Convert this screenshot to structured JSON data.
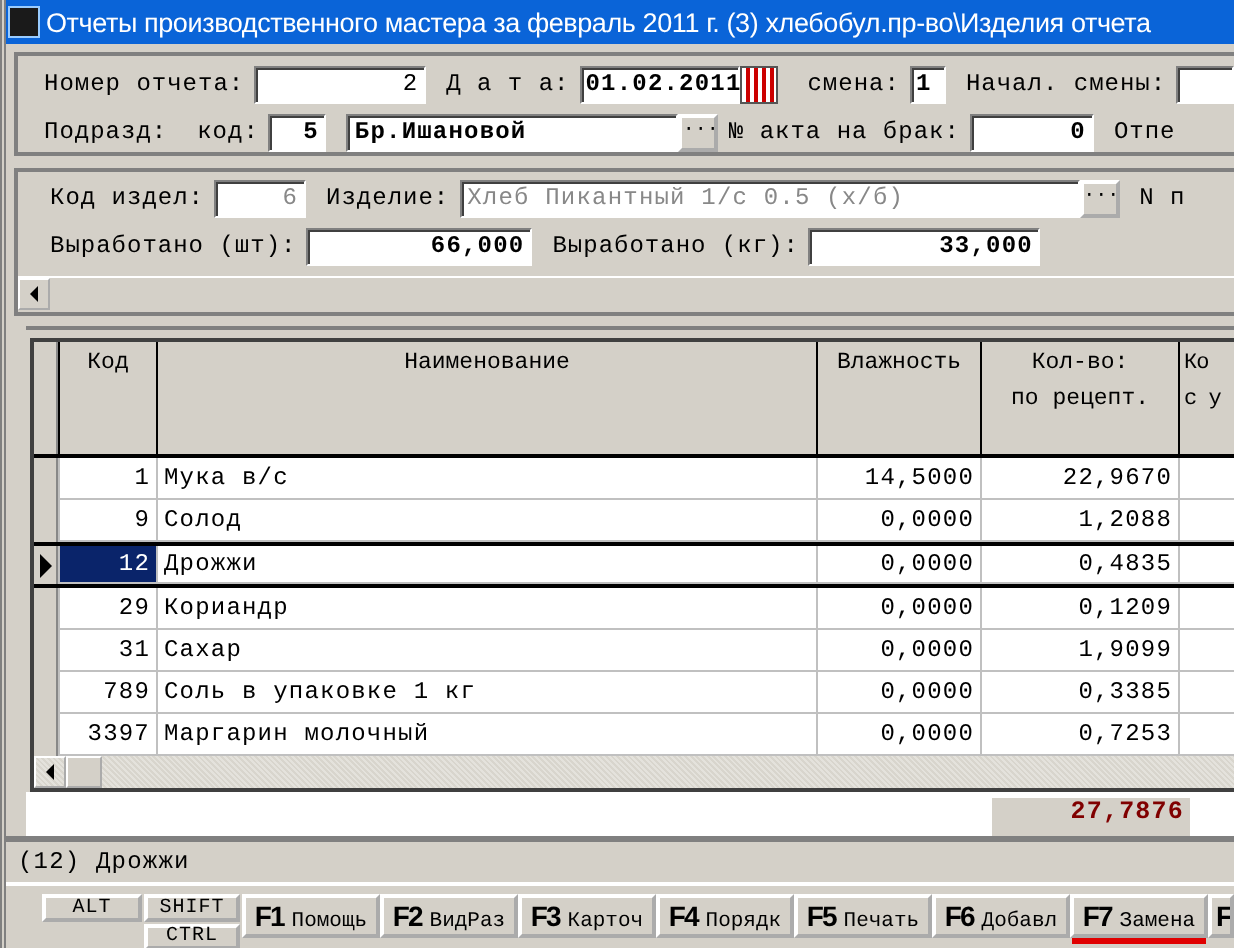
{
  "window": {
    "title": "Отчеты производственного мастера за февраль 2011 г. (3) хлебобул.пр-во\\Изделия отчета"
  },
  "header": {
    "report_number": {
      "label": "Номер отчета:",
      "value": "2"
    },
    "date": {
      "label": "Д а т а:",
      "value": "01.02.2011"
    },
    "shift": {
      "label": "смена:",
      "value": "1"
    },
    "shift_start": {
      "label": "Начал. смены:"
    },
    "subdivision": {
      "label": "Подразд:",
      "code_label": "код:",
      "code": "5",
      "name": "Бр.Ишановой",
      "browse_label": "···"
    },
    "defect_act": {
      "label": "№ акта на брак:",
      "value": "0"
    },
    "cut_label": "Отпе"
  },
  "product": {
    "code_label": "Код издел:",
    "code": "6",
    "product_label": "Изделие:",
    "product_value": "Хлеб Пикантный 1/с 0.5 (х/б)",
    "browse_label": "···",
    "n_label": "N п",
    "produced_pcs": {
      "label": "Выработано (шт):",
      "value": "66,000"
    },
    "produced_kg": {
      "label": "Выработано (кг):",
      "value": "33,000"
    }
  },
  "table": {
    "columns": [
      [
        "Код"
      ],
      [
        "Наименование"
      ],
      [
        "Влажность"
      ],
      [
        "Кол-во:",
        "по рецепт."
      ],
      [
        "Ко",
        "с у"
      ]
    ],
    "rows": [
      {
        "code": "1",
        "name": "Мука в/с",
        "humidity": "14,5000",
        "qty": "22,9670",
        "selected": false
      },
      {
        "code": "9",
        "name": "Солод",
        "humidity": "0,0000",
        "qty": "1,2088",
        "selected": false
      },
      {
        "code": "12",
        "name": "Дрожжи",
        "humidity": "0,0000",
        "qty": "0,4835",
        "selected": true
      },
      {
        "code": "29",
        "name": "Кориандр",
        "humidity": "0,0000",
        "qty": "0,1209",
        "selected": false
      },
      {
        "code": "31",
        "name": "Сахар",
        "humidity": "0,0000",
        "qty": "1,9099",
        "selected": false
      },
      {
        "code": "789",
        "name": "Соль в упаковке 1 кг",
        "humidity": "0,0000",
        "qty": "0,3385",
        "selected": false
      },
      {
        "code": "3397",
        "name": "Маргарин молочный",
        "humidity": "0,0000",
        "qty": "0,7253",
        "selected": false
      }
    ],
    "total": "27,7876"
  },
  "status_bar": "(12) Дрожжи",
  "modifier_keys": [
    "ALT",
    "SHIFT",
    "CTRL"
  ],
  "function_keys": [
    {
      "key": "F1",
      "label": "Помощь",
      "selected": false
    },
    {
      "key": "F2",
      "label": "ВидРаз",
      "selected": false
    },
    {
      "key": "F3",
      "label": "Карточ",
      "selected": false
    },
    {
      "key": "F4",
      "label": "Порядк",
      "selected": false
    },
    {
      "key": "F5",
      "label": "Печать",
      "selected": false
    },
    {
      "key": "F6",
      "label": "Добавл",
      "selected": false
    },
    {
      "key": "F7",
      "label": "Замена",
      "selected": true
    },
    {
      "key": "F",
      "selected": false
    }
  ]
}
